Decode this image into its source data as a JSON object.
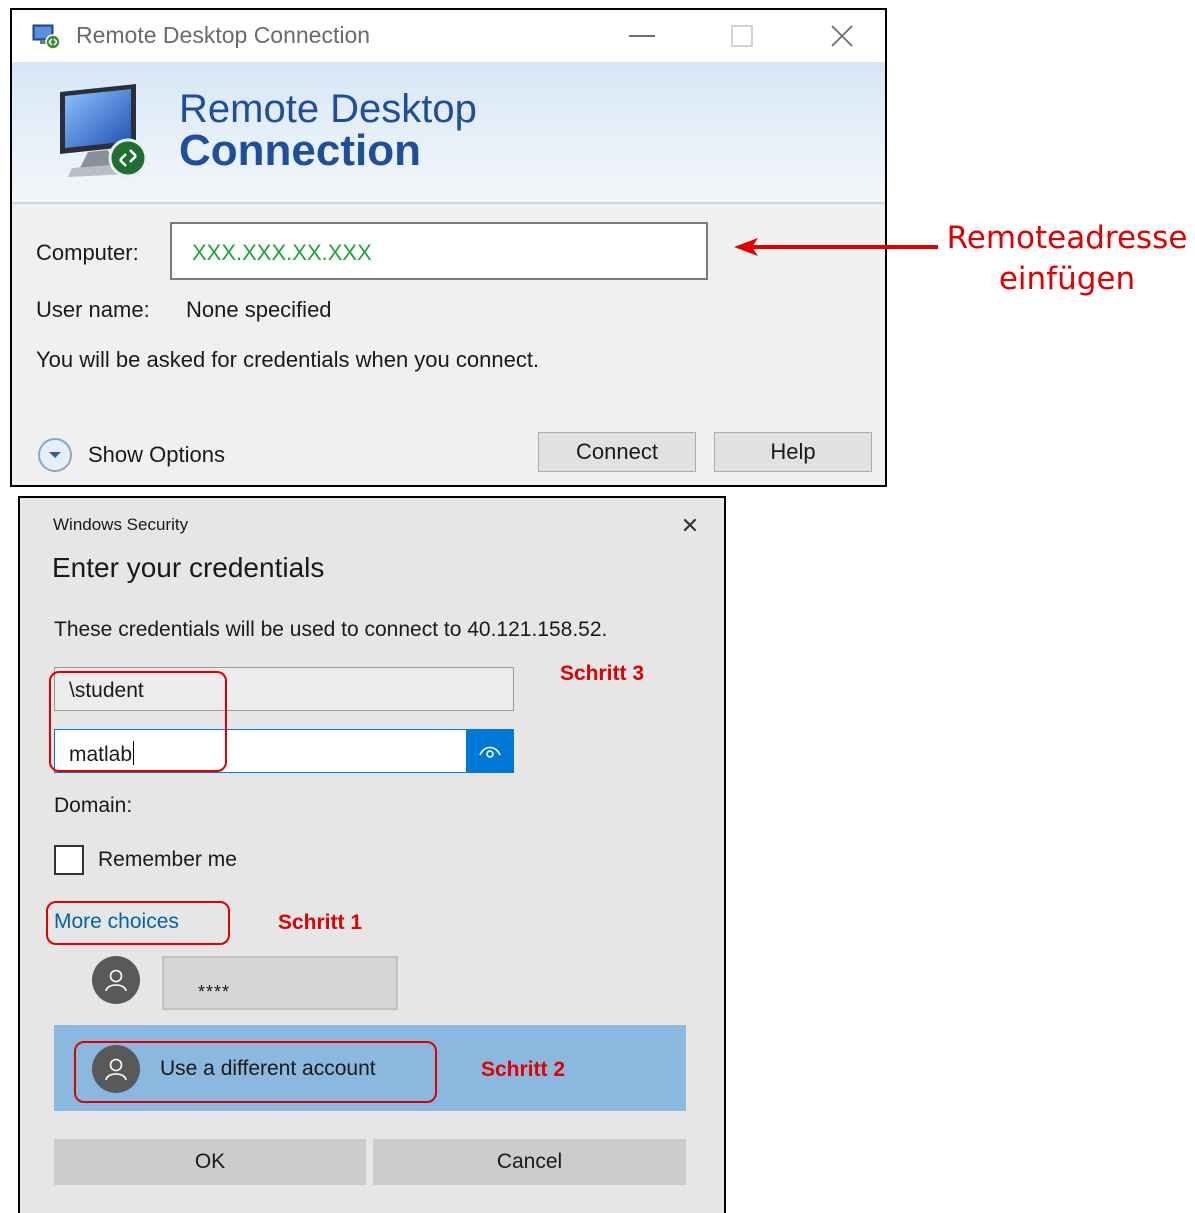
{
  "rdc": {
    "window_title": "Remote Desktop Connection",
    "banner_line1": "Remote Desktop",
    "banner_line2": "Connection",
    "computer_label": "Computer:",
    "computer_value": "XXX.XXX.XX.XXX",
    "username_label": "User name:",
    "username_value": "None specified",
    "info_text": "You will be asked for credentials when you connect.",
    "show_options_label": "Show Options",
    "connect_label": "Connect",
    "help_label": "Help"
  },
  "annotation": {
    "remote_address_line1": "Remoteadresse",
    "remote_address_line2": "einfügen",
    "step1": "Schritt 1",
    "step2": "Schritt 2",
    "step3": "Schritt 3"
  },
  "security": {
    "window_title": "Windows Security",
    "close_glyph": "✕",
    "heading": "Enter your credentials",
    "description": "These credentials will be used to connect to 40.121.158.52.",
    "username_value": "\\student",
    "password_value": "matlab",
    "domain_label": "Domain:",
    "remember_label": "Remember me",
    "more_choices_label": "More choices",
    "saved_account_masked": "****",
    "different_account_label": "Use a different account",
    "ok_label": "OK",
    "cancel_label": "Cancel"
  },
  "colors": {
    "annotation_red": "#e00000",
    "computer_value_green": "#1ea53a",
    "accent_blue": "#0078d7",
    "selected_row": "#8ab8df",
    "banner_title_blue": "#1f4e9c"
  }
}
